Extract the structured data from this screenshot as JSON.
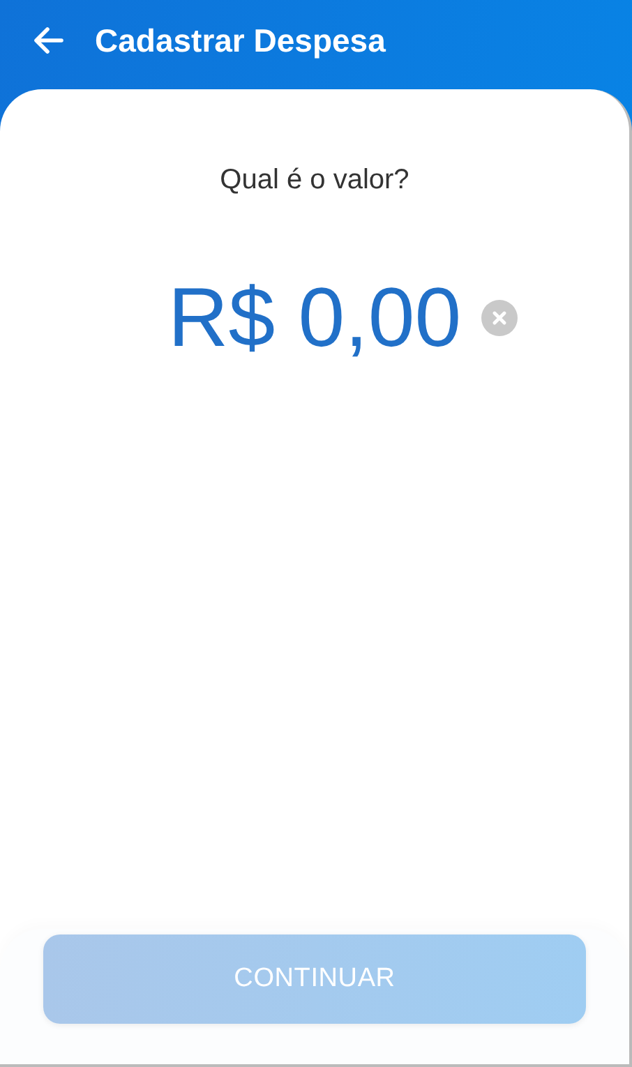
{
  "header": {
    "title": "Cadastrar Despesa"
  },
  "question": "Qual é o valor?",
  "amount": {
    "value": "R$ 0,00"
  },
  "continue_button": {
    "label": "CONTINUAR",
    "disabled": true
  }
}
